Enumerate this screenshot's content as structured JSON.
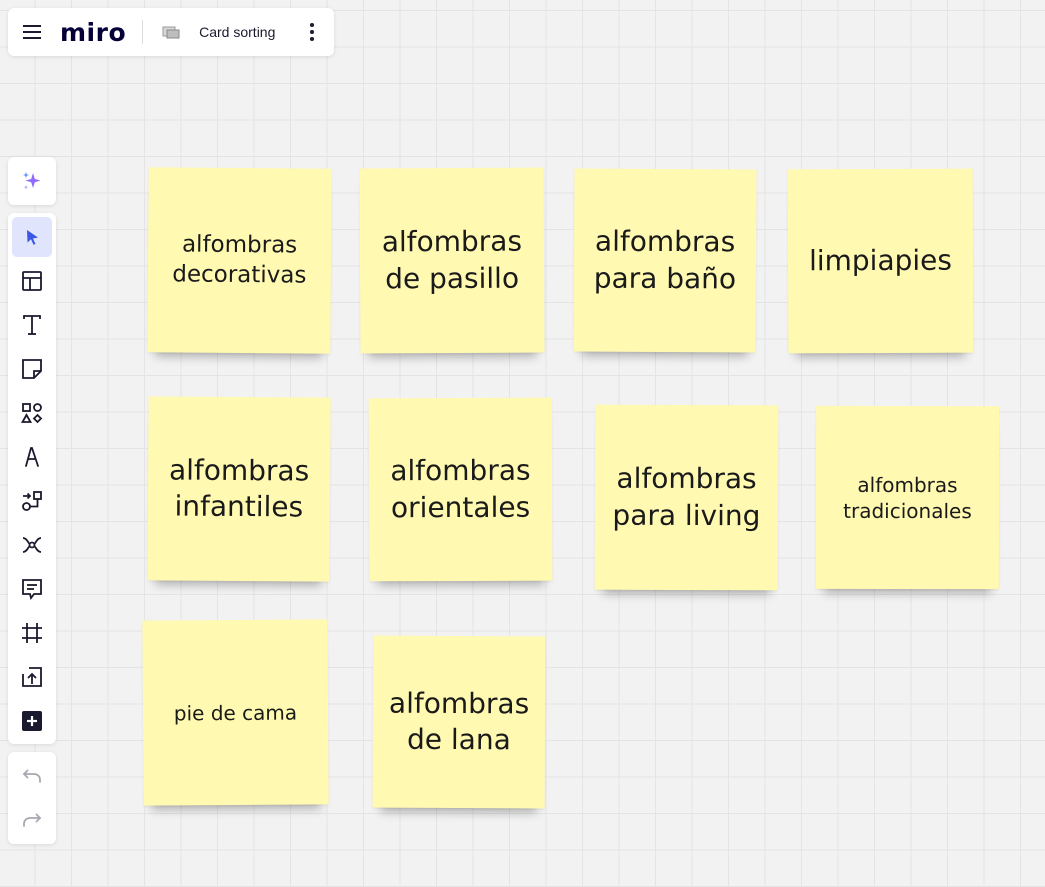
{
  "header": {
    "logo": "miro",
    "board_title": "Card sorting"
  },
  "toolbar": {
    "icons": [
      "magic-sparkle-icon",
      "select-cursor-icon",
      "templates-icon",
      "text-icon",
      "sticky-note-icon",
      "shapes-icon",
      "pen-icon",
      "diagram-icon",
      "mind-map-icon",
      "comment-icon",
      "frame-icon",
      "upload-icon",
      "add-more-icon",
      "undo-icon",
      "redo-icon"
    ],
    "active_tool": "select"
  },
  "colors": {
    "sticky_yellow": "#fff9b1",
    "active_tool_bg": "#e0e4fd",
    "accent_blue": "#4262ff",
    "sparkle_purple": "#9b7bff"
  },
  "stickies": [
    {
      "text": "alfombras decorativas"
    },
    {
      "text": "alfombras de pasillo"
    },
    {
      "text": "alfombras para baño"
    },
    {
      "text": "limpiapies"
    },
    {
      "text": "alfombras infantiles"
    },
    {
      "text": "alfombras orientales"
    },
    {
      "text": "alfombras para living"
    },
    {
      "text": "alfombras tradicionales"
    },
    {
      "text": "pie de cama"
    },
    {
      "text": "alfombras de lana"
    }
  ]
}
